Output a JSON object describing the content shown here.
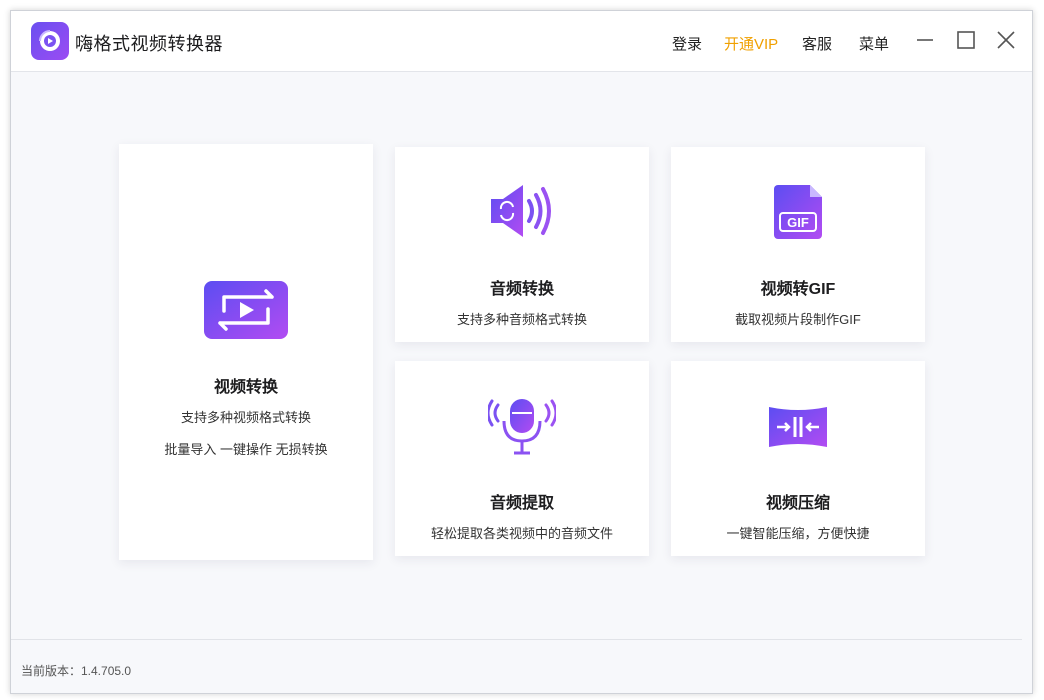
{
  "app": {
    "title": "嗨格式视频转换器",
    "logo_icon": "app-logo-icon"
  },
  "header": {
    "login": "登录",
    "vip": "开通VIP",
    "service": "客服",
    "menu": "菜单",
    "vip_color": "#f0a000"
  },
  "window_controls": {
    "minimize_icon": "minimize-icon",
    "maximize_icon": "maximize-icon",
    "close_icon": "close-icon"
  },
  "cards": {
    "video_convert": {
      "title": "视频转换",
      "desc1": "支持多种视频格式转换",
      "desc2": "批量导入 一键操作 无损转换",
      "icon": "video-convert-icon"
    },
    "audio_convert": {
      "title": "音频转换",
      "desc": "支持多种音频格式转换",
      "icon": "speaker-convert-icon"
    },
    "video_gif": {
      "title": "视频转GIF",
      "desc": "截取视频片段制作GIF",
      "icon_text": "GIF",
      "icon": "gif-file-icon"
    },
    "audio_extract": {
      "title": "音频提取",
      "desc": "轻松提取各类视频中的音频文件",
      "icon": "microphone-icon"
    },
    "video_compress": {
      "title": "视频压缩",
      "desc": "一键智能压缩，方便快捷",
      "icon": "compress-icon"
    }
  },
  "footer": {
    "version": "当前版本：1.4.705.0"
  },
  "colors": {
    "accent_start": "#6a4ff0",
    "accent_end": "#a24cf2"
  }
}
